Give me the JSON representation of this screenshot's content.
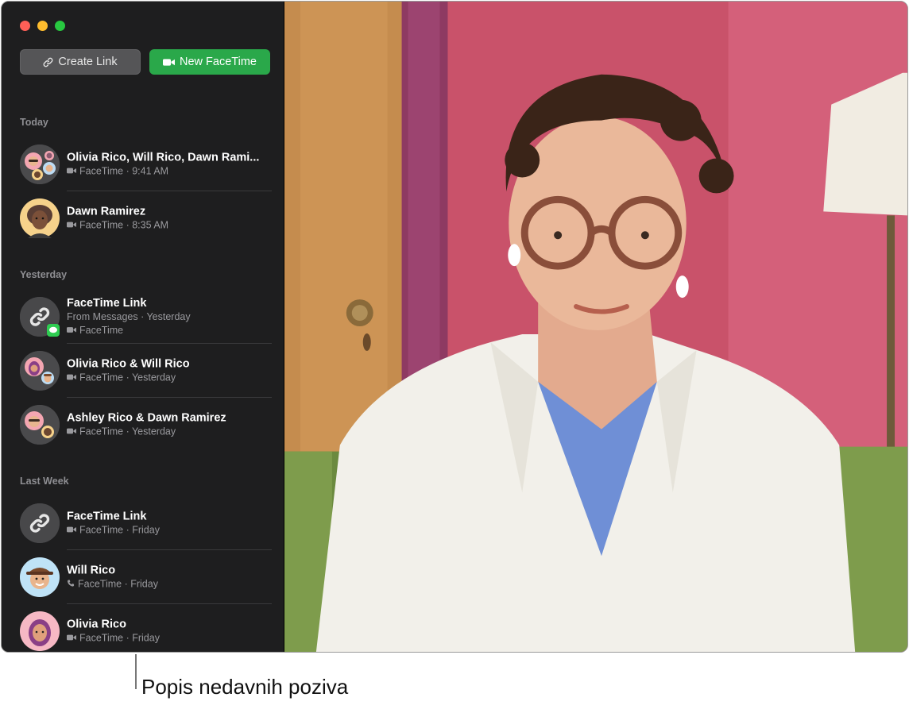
{
  "window": {
    "traffic_lights": {
      "close": "#fe5f57",
      "minimize": "#febc2e",
      "maximize": "#28c840"
    }
  },
  "toolbar": {
    "create_link_label": "Create Link",
    "create_link_icon": "link-icon",
    "new_facetime_label": "New FaceTime",
    "new_facetime_icon": "video-camera-icon",
    "accent_color": "#2aa84a"
  },
  "sections": {
    "today": "Today",
    "yesterday": "Yesterday",
    "last_week": "Last Week"
  },
  "calls": [
    {
      "title": "Olivia Rico, Will Rico, Dawn Rami...",
      "subtitle": "FaceTime · 9:41 AM",
      "call_type": "video-icon",
      "avatar": "group-memoji"
    },
    {
      "title": "Dawn Ramirez",
      "subtitle": "FaceTime · 8:35 AM",
      "call_type": "video-icon",
      "avatar": "memoji"
    },
    {
      "title": "FaceTime Link",
      "subtitle": "From Messages · Yesterday",
      "subtitle2": "FaceTime",
      "call_type": "video-icon",
      "avatar": "link-icon",
      "badge": "messages-icon"
    },
    {
      "title": "Olivia Rico & Will Rico",
      "subtitle": "FaceTime · Yesterday",
      "call_type": "video-icon",
      "avatar": "group-memoji"
    },
    {
      "title": "Ashley Rico & Dawn Ramirez",
      "subtitle": "FaceTime · Yesterday",
      "call_type": "video-icon",
      "avatar": "group-memoji"
    },
    {
      "title": "FaceTime Link",
      "subtitle": "FaceTime · Friday",
      "call_type": "video-icon",
      "avatar": "link-icon"
    },
    {
      "title": "Will Rico",
      "subtitle": "FaceTime · Friday",
      "call_type": "phone-icon",
      "avatar": "memoji"
    },
    {
      "title": "Olivia Rico",
      "subtitle": "FaceTime · Friday",
      "call_type": "video-icon",
      "avatar": "memoji"
    }
  ],
  "callout": {
    "label": "Popis nedavnih poziva"
  }
}
